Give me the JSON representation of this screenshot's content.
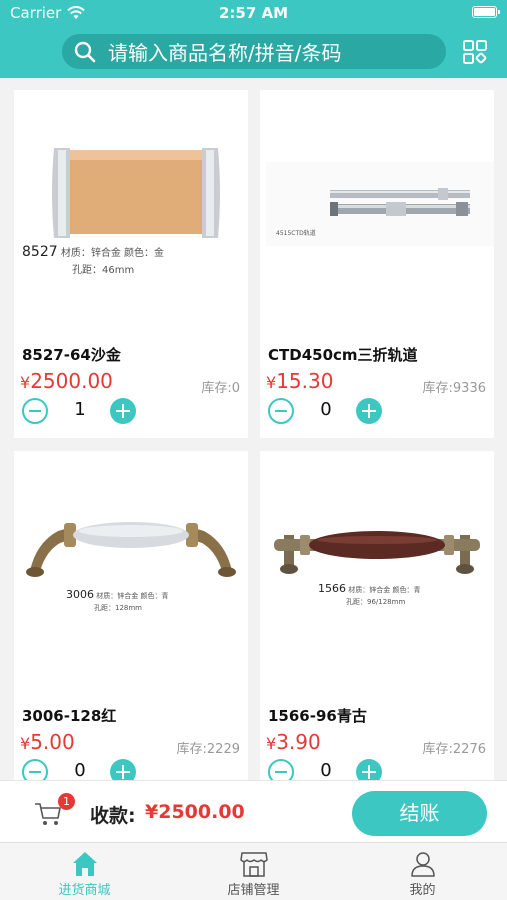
{
  "status_bar": {
    "carrier": "Carrier",
    "time": "2:57 AM"
  },
  "search": {
    "placeholder": "请输入商品名称/拼音/条码"
  },
  "colors": {
    "accent": "#3cc7c3",
    "price": "#e53935"
  },
  "products": [
    {
      "name": "8527-64沙金",
      "currency": "¥",
      "price": "2500.00",
      "stock": "库存:0",
      "quantity": "1",
      "image_text": {
        "model": "8527",
        "line1": "材质：锌合金 颜色：金",
        "line2": "孔距：46mm"
      }
    },
    {
      "name": "CTD450cm三折轨道",
      "currency": "¥",
      "price": "15.30",
      "stock": "库存:9336",
      "quantity": "0",
      "image_text": {
        "label": "4515CTD轨道"
      }
    },
    {
      "name": "3006-128红",
      "currency": "¥",
      "price": "5.00",
      "stock": "库存:2229",
      "quantity": "0",
      "image_text": {
        "model": "3006",
        "line1": "材质：锌合金 颜色：青",
        "line2": "孔距：128mm"
      }
    },
    {
      "name": "1566-96青古",
      "currency": "¥",
      "price": "3.90",
      "stock": "库存:2276",
      "quantity": "0",
      "image_text": {
        "model": "1566",
        "line1": "材质：锌合金 颜色：青",
        "line2": "孔距：96/128mm"
      }
    }
  ],
  "checkout": {
    "cart_badge": "1",
    "total_label": "收款:",
    "total_amount": "¥2500.00",
    "pay_label": "结账"
  },
  "tabbar": {
    "items": [
      {
        "label": "进货商城",
        "icon": "home-icon",
        "active": true
      },
      {
        "label": "店铺管理",
        "icon": "store-icon",
        "active": false
      },
      {
        "label": "我的",
        "icon": "user-icon",
        "active": false
      }
    ]
  }
}
